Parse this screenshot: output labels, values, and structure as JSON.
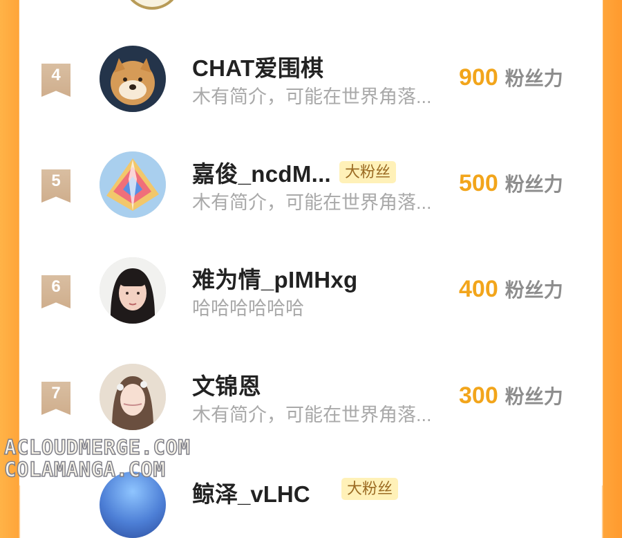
{
  "score_unit": "粉丝力",
  "rows": [
    {
      "rank": "4",
      "username": "CHAT爱围棋",
      "tag": "",
      "bio": "木有简介，可能在世界角落...",
      "score": "900"
    },
    {
      "rank": "5",
      "username": "嘉俊_ncdM...",
      "tag": "大粉丝",
      "bio": "木有简介，可能在世界角落...",
      "score": "500"
    },
    {
      "rank": "6",
      "username": "难为情_pIMHxg",
      "tag": "",
      "bio": "哈哈哈哈哈哈",
      "score": "400"
    },
    {
      "rank": "7",
      "username": "文锦恩",
      "tag": "",
      "bio": "木有简介，可能在世界角落...",
      "score": "300"
    }
  ],
  "partial_row": {
    "username": "鲸泽_vLHC",
    "tag": "大粉丝"
  },
  "watermarks": {
    "line1": "ACLOUDMERGE.COM",
    "line2": "COLAMANGA.COM"
  },
  "colors": {
    "accent_orange": "#F2A51B",
    "rank_badge": "#D9BEA1",
    "tag_background": "#FFF1B8",
    "name_text": "#222222",
    "secondary_text": "#A9A9A9"
  }
}
